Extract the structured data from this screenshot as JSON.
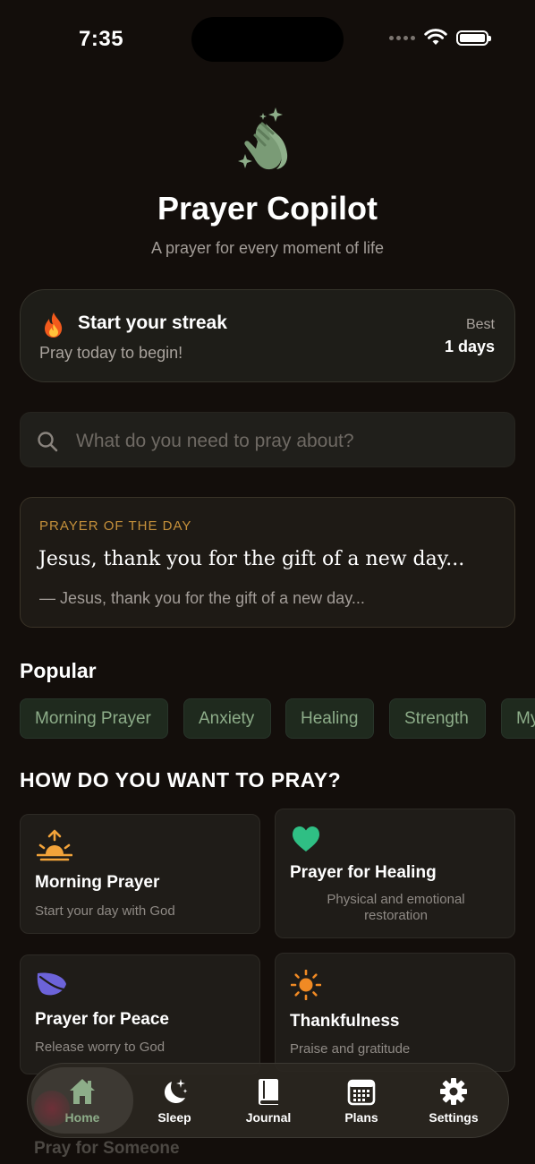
{
  "status_bar": {
    "time": "7:35"
  },
  "header": {
    "title": "Prayer Copilot",
    "tagline": "A prayer for every moment of life",
    "logo_icon": "praying-hands-sparkle",
    "accent_color": "#8dad89"
  },
  "streak": {
    "icon": "fire",
    "title": "Start your streak",
    "subtitle": "Pray today to begin!",
    "best_label": "Best",
    "best_value": "1 days"
  },
  "search": {
    "placeholder": "What do you need to pray about?",
    "value": ""
  },
  "prayer_of_the_day": {
    "label": "PRAYER OF THE DAY",
    "title": "Jesus, thank you for the gift of a new day...",
    "quote": "— Jesus, thank you for the gift of a new day..."
  },
  "popular": {
    "heading": "Popular",
    "chips": [
      "Morning Prayer",
      "Anxiety",
      "Healing",
      "Strength",
      "My"
    ]
  },
  "how_to_pray": {
    "heading": "HOW DO YOU WANT TO PRAY?",
    "cards": [
      {
        "icon": "sunrise",
        "title": "Morning Prayer",
        "description": "Start your day with God",
        "color": "#f2a33a"
      },
      {
        "icon": "heart",
        "title": "Prayer for Healing",
        "description": "Physical and emotional restoration",
        "color": "#2fbf84"
      },
      {
        "icon": "leaf",
        "title": "Prayer for Peace",
        "description": "Release worry to God",
        "color": "#6c63d9"
      },
      {
        "icon": "sun",
        "title": "Thankfulness",
        "description": "Praise and gratitude",
        "color": "#f08a24"
      }
    ],
    "behind_item": "Pray for Someone"
  },
  "tab_bar": {
    "tabs": [
      {
        "icon": "house",
        "label": "Home",
        "active": true
      },
      {
        "icon": "moon-stars",
        "label": "Sleep",
        "active": false
      },
      {
        "icon": "book",
        "label": "Journal",
        "active": false
      },
      {
        "icon": "calendar",
        "label": "Plans",
        "active": false
      },
      {
        "icon": "gear",
        "label": "Settings",
        "active": false
      }
    ]
  }
}
